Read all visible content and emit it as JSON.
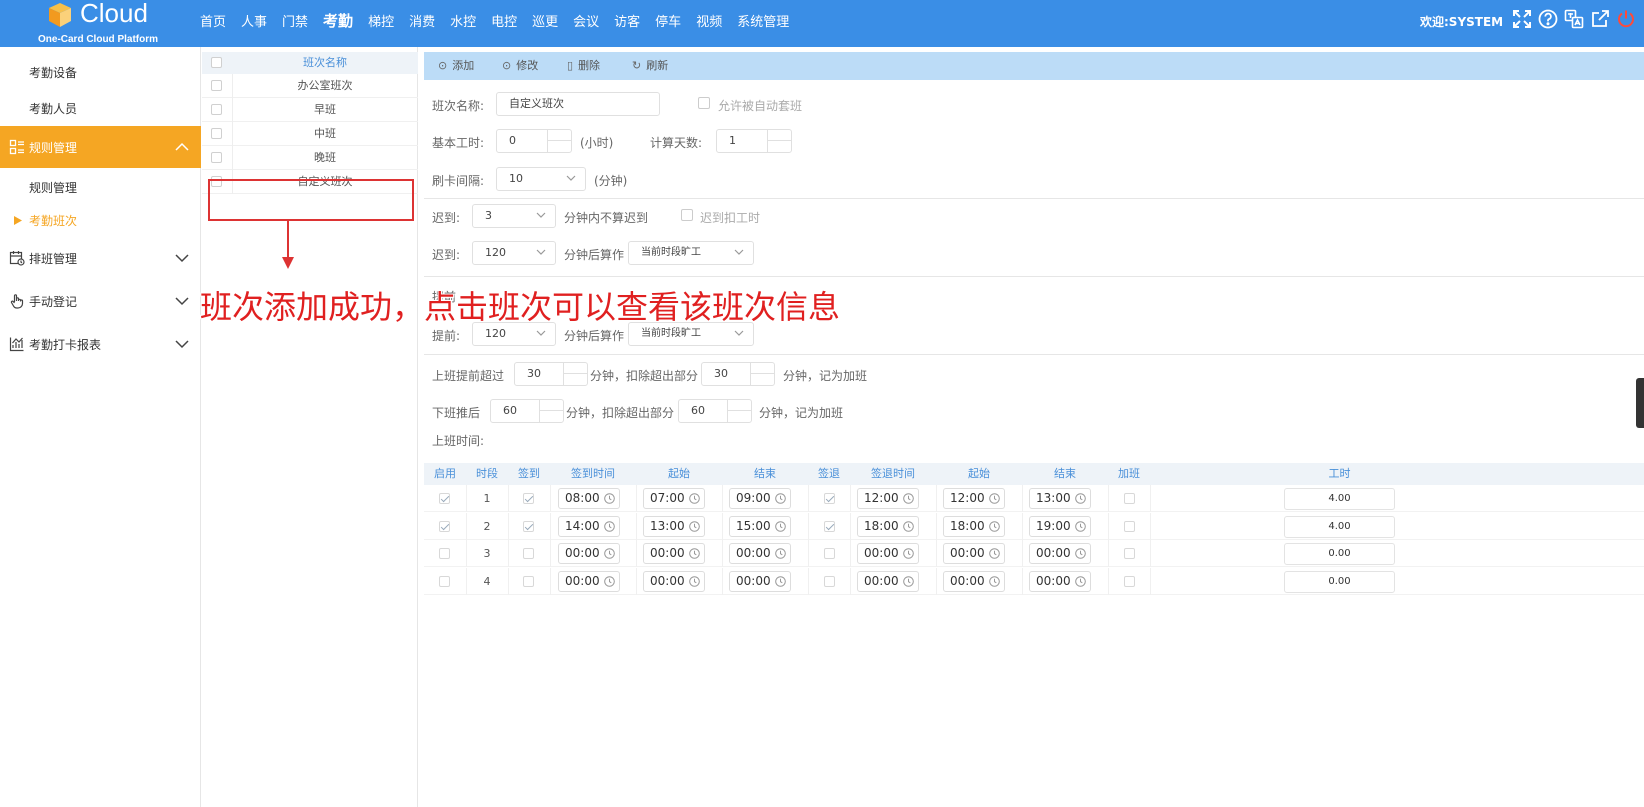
{
  "brand": {
    "name": "Cloud",
    "subtitle": "One-Card Cloud Platform"
  },
  "nav": [
    "首页",
    "人事",
    "门禁",
    "考勤",
    "梯控",
    "消费",
    "水控",
    "电控",
    "巡更",
    "会议",
    "访客",
    "停车",
    "视频",
    "系统管理"
  ],
  "nav_active": "考勤",
  "welcome": "欢迎:SYSTEM",
  "top_icons": [
    "fullscreen-icon",
    "help-icon",
    "translate-icon",
    "external-link-icon",
    "power-icon"
  ],
  "sidebar": {
    "attendance_device": "考勤设备",
    "attendance_staff": "考勤人员",
    "rule_group": "规则管理",
    "rule_manage": "规则管理",
    "shift": "考勤班次",
    "schedule": "排班管理",
    "manual": "手动登记",
    "report": "考勤打卡报表"
  },
  "shift_list": {
    "header": "班次名称",
    "rows": [
      "办公室班次",
      "早班",
      "中班",
      "晚班",
      "自定义班次"
    ]
  },
  "annotation": "班次添加成功，点击班次可以查看该班次信息",
  "toolbar": {
    "add": "添加",
    "edit": "修改",
    "delete": "删除",
    "refresh": "刷新"
  },
  "form": {
    "shift_name_label": "班次名称:",
    "shift_name_value": "自定义班次",
    "auto_match_label": "允许被自动套班",
    "base_hours_label": "基本工时:",
    "base_hours_value": "0",
    "base_hours_unit": "(小时)",
    "calc_days_label": "计算天数:",
    "calc_days_value": "1",
    "swipe_interval_label": "刷卡间隔:",
    "swipe_interval_value": "10",
    "swipe_interval_unit": "(分钟)",
    "late1_label": "迟到:",
    "late1_value": "3",
    "late1_suffix": "分钟内不算迟到",
    "late_deduct_label": "迟到扣工时",
    "late2_label": "迟到:",
    "late2_value": "120",
    "late2_suffix": "分钟后算作",
    "late2_select": "当前时段旷工",
    "early1_label_partial": "提前",
    "early2_label": "提前:",
    "early2_value": "120",
    "early2_suffix": "分钟后算作",
    "early2_select": "当前时段旷工",
    "ot_before_label": "上班提前超过",
    "ot_before_value": "30",
    "ot_before_mid": "分钟，扣除超出部分",
    "ot_before_value2": "30",
    "ot_before_suffix": "分钟，记为加班",
    "ot_after_label": "下班推后",
    "ot_after_value": "60",
    "ot_after_mid": "分钟，扣除超出部分",
    "ot_after_value2": "60",
    "ot_after_suffix": "分钟，记为加班",
    "work_time_label": "上班时间:"
  },
  "table": {
    "headers": [
      "启用",
      "时段",
      "签到",
      "签到时间",
      "起始",
      "结束",
      "签退",
      "签退时间",
      "起始",
      "结束",
      "加班",
      "工时"
    ],
    "rows": [
      {
        "enabled": true,
        "period": "1",
        "signin": true,
        "signin_time": "08:00",
        "start": "07:00",
        "end": "09:00",
        "signout": true,
        "signout_time": "12:00",
        "start2": "12:00",
        "end2": "13:00",
        "overtime": false,
        "hours": "4.00"
      },
      {
        "enabled": true,
        "period": "2",
        "signin": true,
        "signin_time": "14:00",
        "start": "13:00",
        "end": "15:00",
        "signout": true,
        "signout_time": "18:00",
        "start2": "18:00",
        "end2": "19:00",
        "overtime": false,
        "hours": "4.00"
      },
      {
        "enabled": false,
        "period": "3",
        "signin": false,
        "signin_time": "00:00",
        "start": "00:00",
        "end": "00:00",
        "signout": false,
        "signout_time": "00:00",
        "start2": "00:00",
        "end2": "00:00",
        "overtime": false,
        "hours": "0.00"
      },
      {
        "enabled": false,
        "period": "4",
        "signin": false,
        "signin_time": "00:00",
        "start": "00:00",
        "end": "00:00",
        "signout": false,
        "signout_time": "00:00",
        "start2": "00:00",
        "end2": "00:00",
        "overtime": false,
        "hours": "0.00"
      }
    ]
  },
  "colors": {
    "topbar": "#3a8ee6",
    "accent": "#f5a623",
    "toolbar": "#bcdcf7",
    "annotation": "#e02020"
  }
}
